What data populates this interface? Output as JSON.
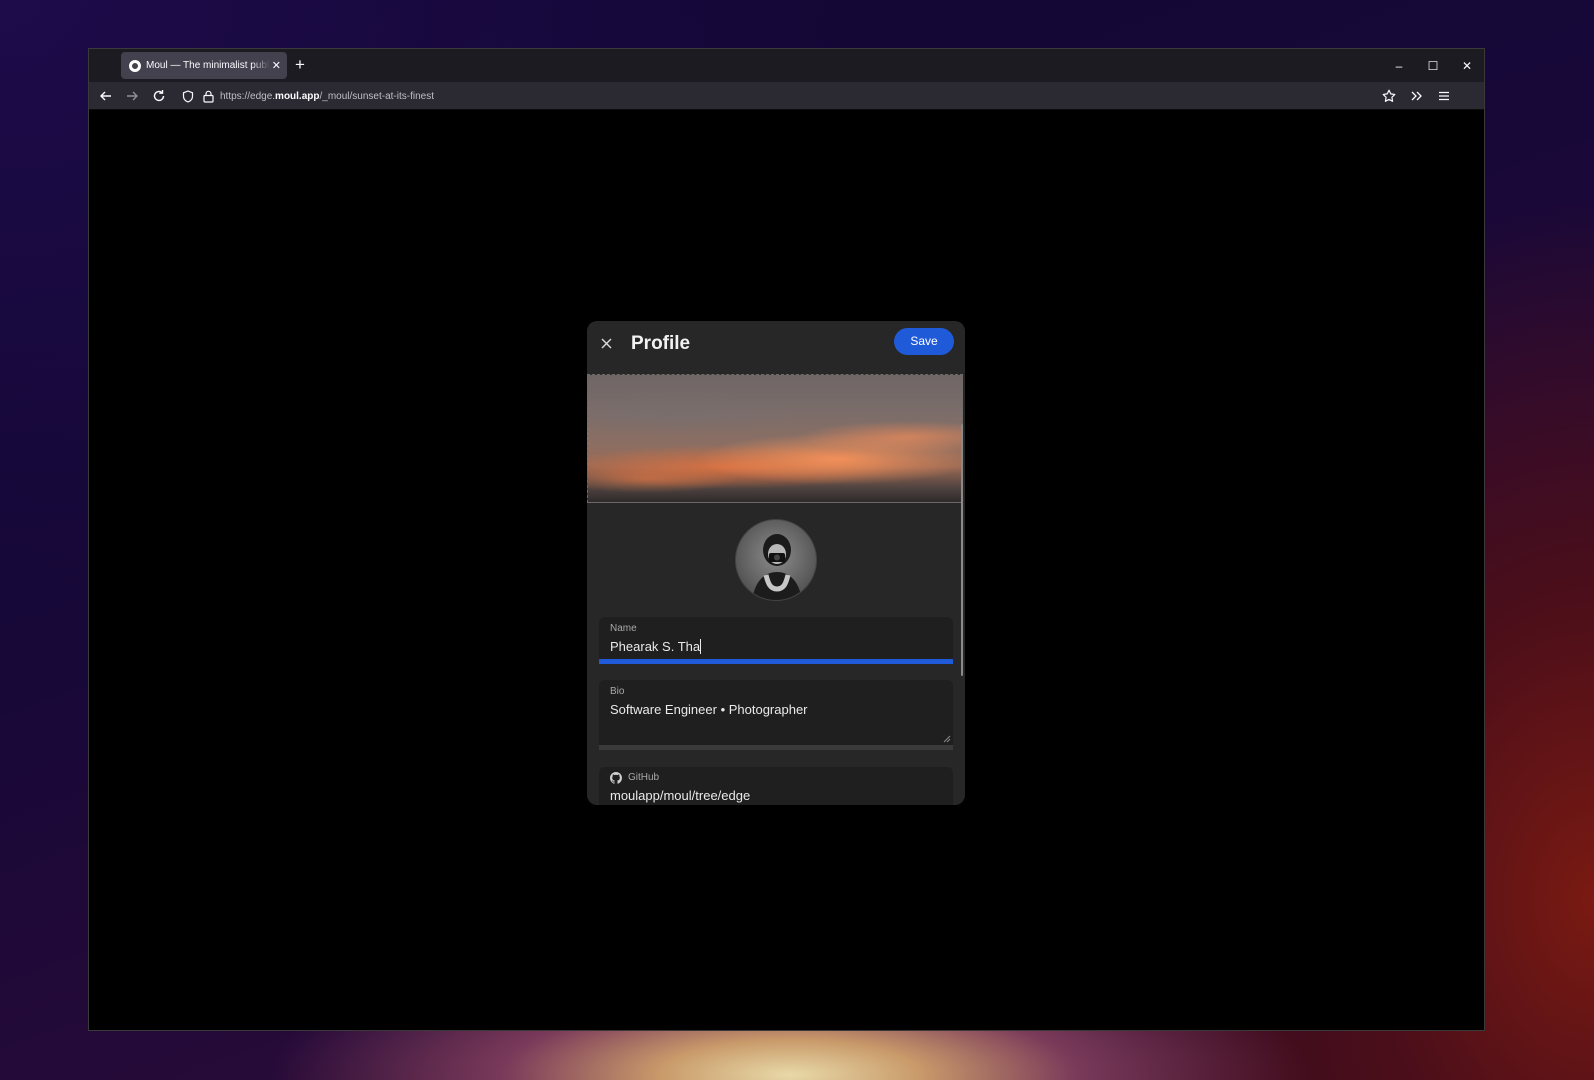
{
  "browser": {
    "tab_title": "Moul — The minimalist publishing",
    "tab_close": "✕",
    "new_tab": "+",
    "window_controls": {
      "minimize": "–",
      "maximize": "☐",
      "close": "✕"
    },
    "url": {
      "prefix": "https://edge.",
      "domain": "moul.app",
      "path": "/_moul/sunset-at-its-finest"
    },
    "icons": [
      "back-icon",
      "forward-icon",
      "reload-icon",
      "shield-icon",
      "lock-icon",
      "star-icon",
      "extensions-icon",
      "menu-icon"
    ]
  },
  "modal": {
    "title": "Profile",
    "close_icon": "close-icon",
    "save_label": "Save",
    "fields": {
      "name": {
        "label": "Name",
        "value": "Phearak S. Tha"
      },
      "bio": {
        "label": "Bio",
        "value": "Software Engineer • Photographer"
      },
      "github": {
        "label": "GitHub",
        "value": "moulapp/moul/tree/edge",
        "icon": "github-icon"
      }
    }
  },
  "colors": {
    "accent": "#1f5bd9",
    "modal_bg": "#272727",
    "field_bg": "#1f1f1f"
  }
}
